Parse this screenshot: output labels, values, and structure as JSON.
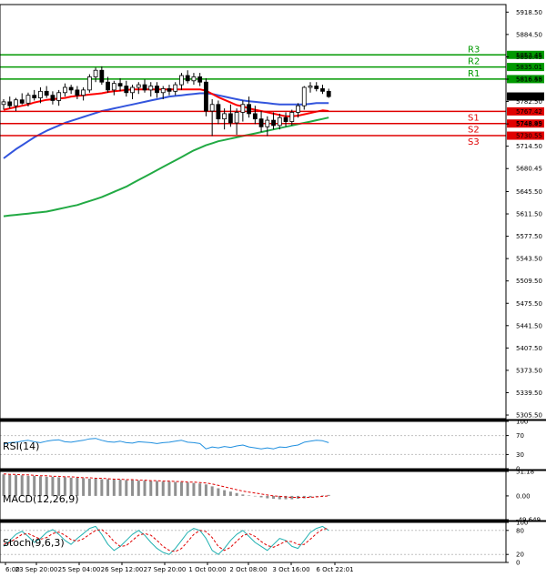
{
  "chart_data": {
    "type": "candlestick",
    "main": {
      "y_ticks": [
        "5918.50",
        "5884.50",
        "5850.45",
        "5816.45",
        "5782.50",
        "5748.45",
        "5714.50",
        "5680.45",
        "5645.50",
        "5611.50",
        "5577.50",
        "5543.50",
        "5509.50",
        "5475.50",
        "5441.50",
        "5407.50",
        "5373.50",
        "5339.50",
        "5305.50"
      ],
      "ylim": [
        5300,
        5930
      ],
      "last_price": "5790.08",
      "pivots": [
        {
          "name": "R3",
          "value": 5853.45,
          "label": "5853.45",
          "color": "#009900"
        },
        {
          "name": "R2",
          "value": 5835.01,
          "label": "5835.01",
          "color": "#009900"
        },
        {
          "name": "R1",
          "value": 5816.58,
          "label": "5816.58",
          "color": "#009900"
        },
        {
          "name": "S1",
          "value": 5767.42,
          "label": "5767.42",
          "color": "#e00000"
        },
        {
          "name": "S2",
          "value": 5748.99,
          "label": "5748.99",
          "color": "#e00000"
        },
        {
          "name": "S3",
          "value": 5730.55,
          "label": "5730.55",
          "color": "#e00000"
        }
      ],
      "candles": [
        [
          5778,
          5786,
          5770,
          5782
        ],
        [
          5782,
          5790,
          5772,
          5776
        ],
        [
          5776,
          5788,
          5768,
          5785
        ],
        [
          5785,
          5795,
          5778,
          5780
        ],
        [
          5780,
          5796,
          5775,
          5792
        ],
        [
          5792,
          5800,
          5784,
          5788
        ],
        [
          5788,
          5804,
          5780,
          5798
        ],
        [
          5798,
          5806,
          5788,
          5792
        ],
        [
          5792,
          5798,
          5778,
          5784
        ],
        [
          5784,
          5800,
          5776,
          5796
        ],
        [
          5796,
          5810,
          5790,
          5804
        ],
        [
          5804,
          5808,
          5794,
          5800
        ],
        [
          5800,
          5806,
          5786,
          5792
        ],
        [
          5792,
          5804,
          5784,
          5800
        ],
        [
          5800,
          5824,
          5796,
          5820
        ],
        [
          5820,
          5834,
          5812,
          5830
        ],
        [
          5830,
          5836,
          5808,
          5812
        ],
        [
          5812,
          5820,
          5796,
          5800
        ],
        [
          5800,
          5814,
          5792,
          5810
        ],
        [
          5810,
          5818,
          5798,
          5806
        ],
        [
          5806,
          5814,
          5790,
          5796
        ],
        [
          5796,
          5808,
          5786,
          5804
        ],
        [
          5804,
          5812,
          5794,
          5808
        ],
        [
          5808,
          5816,
          5796,
          5800
        ],
        [
          5800,
          5812,
          5790,
          5806
        ],
        [
          5806,
          5812,
          5788,
          5796
        ],
        [
          5796,
          5806,
          5786,
          5802
        ],
        [
          5802,
          5808,
          5792,
          5798
        ],
        [
          5798,
          5812,
          5792,
          5808
        ],
        [
          5808,
          5826,
          5800,
          5822
        ],
        [
          5822,
          5830,
          5810,
          5814
        ],
        [
          5814,
          5826,
          5808,
          5820
        ],
        [
          5820,
          5826,
          5806,
          5812
        ],
        [
          5812,
          5818,
          5760,
          5768
        ],
        [
          5768,
          5786,
          5730,
          5778
        ],
        [
          5778,
          5784,
          5748,
          5756
        ],
        [
          5756,
          5772,
          5740,
          5764
        ],
        [
          5764,
          5778,
          5744,
          5750
        ],
        [
          5750,
          5772,
          5732,
          5766
        ],
        [
          5766,
          5784,
          5752,
          5778
        ],
        [
          5778,
          5790,
          5758,
          5764
        ],
        [
          5764,
          5776,
          5748,
          5756
        ],
        [
          5756,
          5768,
          5736,
          5744
        ],
        [
          5744,
          5760,
          5730,
          5754
        ],
        [
          5754,
          5766,
          5740,
          5746
        ],
        [
          5746,
          5764,
          5740,
          5758
        ],
        [
          5758,
          5766,
          5744,
          5752
        ],
        [
          5752,
          5770,
          5746,
          5766
        ],
        [
          5766,
          5780,
          5758,
          5776
        ],
        [
          5776,
          5806,
          5770,
          5804
        ],
        [
          5804,
          5812,
          5796,
          5806
        ],
        [
          5806,
          5812,
          5798,
          5802
        ],
        [
          5802,
          5808,
          5794,
          5798
        ],
        [
          5798,
          5802,
          5788,
          5790
        ]
      ],
      "sma_fast": [
        5770,
        5772,
        5774,
        5776,
        5778,
        5781,
        5783,
        5785,
        5786,
        5787,
        5788,
        5790,
        5791,
        5792,
        5793,
        5794,
        5795,
        5797,
        5798,
        5799,
        5800,
        5801,
        5801,
        5801,
        5801,
        5801,
        5801,
        5801,
        5801,
        5801,
        5801,
        5801,
        5801,
        5799,
        5794,
        5789,
        5785,
        5781,
        5777,
        5775,
        5772,
        5770,
        5768,
        5766,
        5764,
        5762,
        5760,
        5760,
        5761,
        5763,
        5765,
        5767,
        5769,
        5768
      ],
      "sma_mid": [
        5696,
        5703,
        5710,
        5716,
        5722,
        5728,
        5733,
        5738,
        5742,
        5746,
        5750,
        5753,
        5756,
        5759,
        5762,
        5765,
        5768,
        5770,
        5772,
        5774,
        5776,
        5778,
        5780,
        5782,
        5784,
        5786,
        5788,
        5790,
        5791,
        5792,
        5793,
        5794,
        5795,
        5795,
        5794,
        5792,
        5790,
        5788,
        5786,
        5784,
        5783,
        5782,
        5781,
        5780,
        5779,
        5778,
        5778,
        5778,
        5778,
        5778,
        5779,
        5780,
        5780,
        5780
      ],
      "sma_slow": [
        5608,
        5609,
        5610,
        5611,
        5612,
        5613,
        5614,
        5615,
        5617,
        5619,
        5621,
        5623,
        5625,
        5628,
        5631,
        5634,
        5637,
        5641,
        5645,
        5649,
        5653,
        5658,
        5663,
        5668,
        5673,
        5678,
        5683,
        5688,
        5693,
        5698,
        5703,
        5708,
        5712,
        5716,
        5719,
        5722,
        5724,
        5726,
        5728,
        5730,
        5732,
        5734,
        5736,
        5738,
        5740,
        5742,
        5744,
        5746,
        5748,
        5750,
        5752,
        5754,
        5756,
        5758
      ]
    },
    "rsi": {
      "label": "RSI(14)",
      "y_ticks": [
        "100",
        "70",
        "30",
        "0"
      ],
      "values": [
        52,
        55,
        56,
        58,
        60,
        57,
        55,
        58,
        60,
        61,
        57,
        56,
        58,
        60,
        63,
        64,
        60,
        57,
        56,
        58,
        55,
        54,
        57,
        56,
        55,
        53,
        55,
        56,
        58,
        60,
        56,
        55,
        53,
        42,
        46,
        44,
        47,
        45,
        48,
        50,
        46,
        44,
        42,
        44,
        42,
        46,
        45,
        48,
        50,
        56,
        58,
        60,
        59,
        55
      ]
    },
    "macd": {
      "label": "MACD(12,26,9)",
      "y_ticks": [
        "51.18",
        "0.00",
        "-49.649"
      ],
      "histogram": [
        45,
        44,
        44,
        43,
        42,
        42,
        41,
        40,
        40,
        39,
        39,
        38,
        38,
        37,
        36,
        36,
        35,
        35,
        34,
        34,
        33,
        33,
        32,
        32,
        31,
        31,
        30,
        30,
        29,
        29,
        28,
        27,
        26,
        24,
        20,
        16,
        12,
        9,
        6,
        3,
        1,
        -1,
        -3,
        -5,
        -6,
        -7,
        -7,
        -7,
        -6,
        -5,
        -3,
        -1,
        1,
        2
      ],
      "signal": [
        46,
        45,
        45,
        44,
        44,
        43,
        42,
        42,
        41,
        41,
        40,
        40,
        39,
        38,
        38,
        37,
        37,
        36,
        35,
        35,
        34,
        34,
        33,
        33,
        32,
        32,
        31,
        31,
        30,
        30,
        29,
        29,
        28,
        27,
        25,
        22,
        19,
        16,
        13,
        10,
        8,
        6,
        4,
        2,
        0,
        -1,
        -2,
        -3,
        -3,
        -3,
        -3,
        -2,
        -1,
        0
      ]
    },
    "stoch": {
      "label": "Stoch(9,6,3)",
      "y_ticks": [
        "100",
        "80",
        "20",
        "0"
      ],
      "main": [
        40,
        55,
        70,
        78,
        65,
        50,
        60,
        75,
        82,
        70,
        55,
        45,
        60,
        72,
        85,
        90,
        70,
        45,
        30,
        40,
        55,
        70,
        80,
        68,
        50,
        35,
        25,
        20,
        35,
        55,
        75,
        85,
        80,
        60,
        30,
        20,
        35,
        55,
        70,
        80,
        65,
        50,
        40,
        30,
        45,
        60,
        55,
        40,
        35,
        55,
        75,
        85,
        90,
        80
      ],
      "signal": [
        45,
        50,
        60,
        70,
        72,
        65,
        58,
        62,
        72,
        76,
        68,
        57,
        53,
        59,
        70,
        80,
        82,
        70,
        52,
        40,
        42,
        55,
        68,
        72,
        68,
        55,
        40,
        30,
        27,
        35,
        52,
        70,
        80,
        77,
        62,
        40,
        30,
        38,
        53,
        67,
        72,
        65,
        52,
        42,
        38,
        45,
        53,
        52,
        45,
        45,
        58,
        72,
        83,
        85
      ]
    },
    "x_ticks": [
      "6:00",
      "23 Sep 20:00",
      "25 Sep 04:00",
      "26 Sep 12:00",
      "27 Sep 20:00",
      "1 Oct 00:00",
      "2 Oct 08:00",
      "3 Oct 16:00",
      "6 Oct 22:01"
    ],
    "colors": {
      "bull": "#009900",
      "bear": "#e00000",
      "sma_fast": "#ff0000",
      "sma_mid": "#3355dd",
      "sma_slow": "#22aa44",
      "rsi": "#1f8fdf",
      "macd_hist": "#909090",
      "macd_signal": "#e00000",
      "stoch_main": "#1fb0b0",
      "stoch_signal": "#e00000"
    }
  }
}
